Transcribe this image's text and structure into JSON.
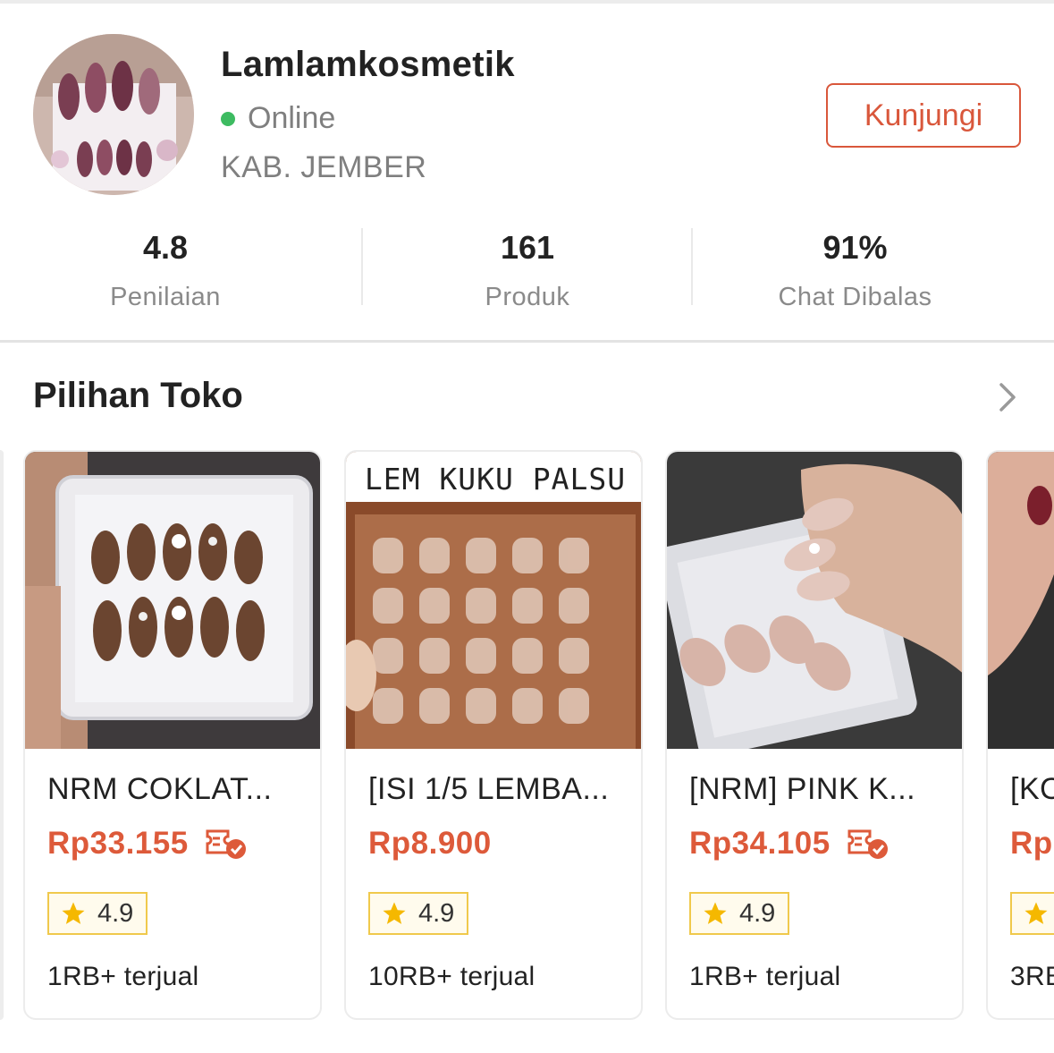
{
  "shop": {
    "name": "Lamlamkosmetik",
    "status": "Online",
    "location": "KAB. JEMBER",
    "visit_label": "Kunjungi"
  },
  "stats": [
    {
      "value": "4.8",
      "label": "Penilaian"
    },
    {
      "value": "161",
      "label": "Produk"
    },
    {
      "value": "91%",
      "label": "Chat Dibalas"
    }
  ],
  "section": {
    "title": "Pilihan Toko"
  },
  "products": [
    {
      "title": "NRM COKLAT...",
      "price": "Rp33.155",
      "has_coupon": true,
      "rating": "4.9",
      "sold": "1RB+ terjual",
      "image_text": ""
    },
    {
      "title": "[ISI 1/5 LEMBA...",
      "price": "Rp8.900",
      "has_coupon": false,
      "rating": "4.9",
      "sold": "10RB+ terjual",
      "image_text": "LEM KUKU PALSU"
    },
    {
      "title": "[NRM] PINK K...",
      "price": "Rp34.105",
      "has_coupon": true,
      "rating": "4.9",
      "sold": "1RB+ terjual",
      "image_text": ""
    },
    {
      "title": "[KO",
      "price": "Rp",
      "has_coupon": false,
      "rating": "",
      "sold": "3RB",
      "image_text": ""
    }
  ],
  "colors": {
    "accent": "#dd5a3a",
    "online": "#3dbb61",
    "rating_border": "#f0c94c",
    "star": "#f5b800"
  }
}
